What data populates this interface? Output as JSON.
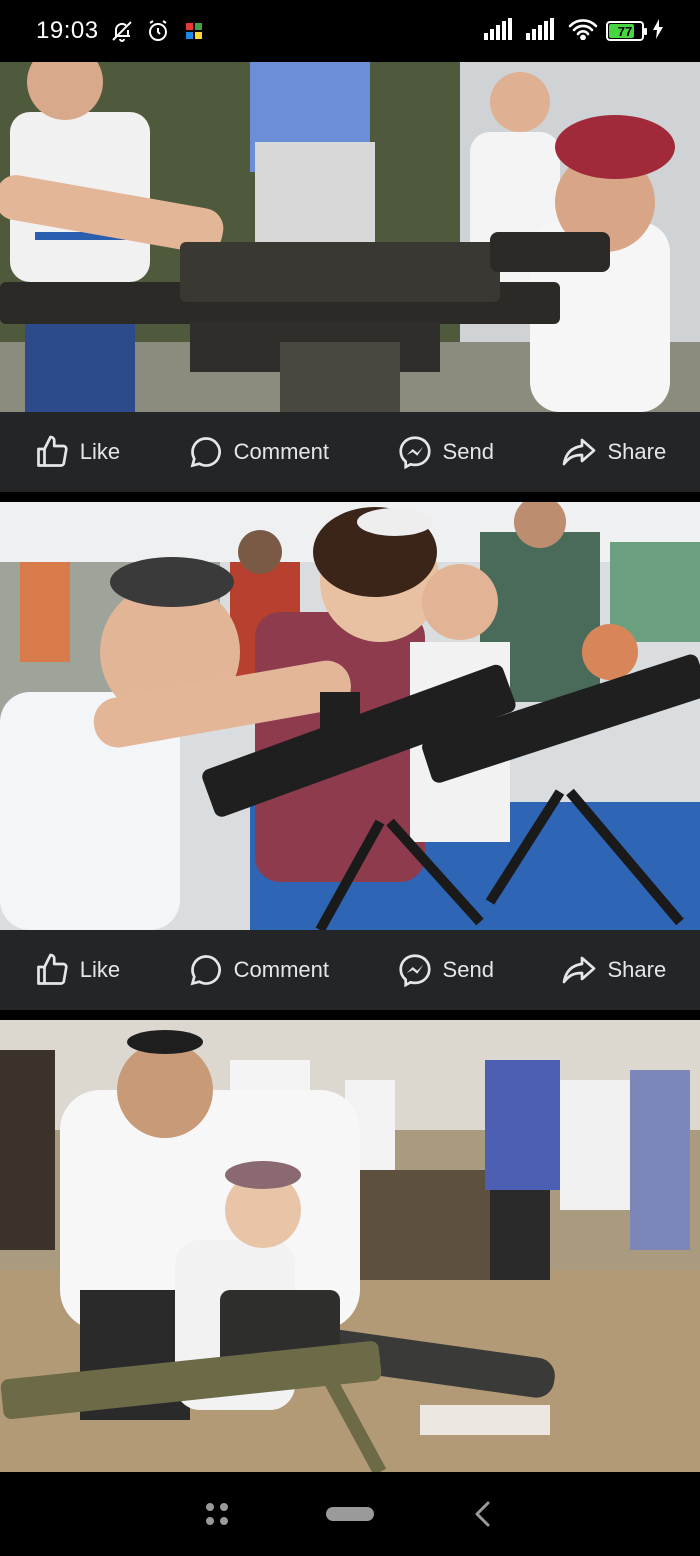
{
  "status_bar": {
    "time": "19:03",
    "battery_level": "77",
    "battery_fraction": 0.77,
    "icons": [
      "bell-off-icon",
      "alarm-icon",
      "app-notification-icon",
      "signal-icon",
      "signal-icon",
      "wifi-icon",
      "battery-icon",
      "charging-icon"
    ]
  },
  "posts": [
    {
      "photo_description_icon": "photo",
      "actions": {
        "like": "Like",
        "comment": "Comment",
        "send": "Send",
        "share": "Share"
      }
    },
    {
      "photo_description_icon": "photo",
      "actions": {
        "like": "Like",
        "comment": "Comment",
        "send": "Send",
        "share": "Share"
      }
    },
    {
      "photo_description_icon": "photo"
    }
  ],
  "nav_bar": {
    "icons": [
      "menu-icon",
      "home-pill-icon",
      "back-icon"
    ]
  },
  "colors": {
    "action_bar": "#242526",
    "action_text": "#e4e6eb",
    "battery_green": "#47d642"
  }
}
